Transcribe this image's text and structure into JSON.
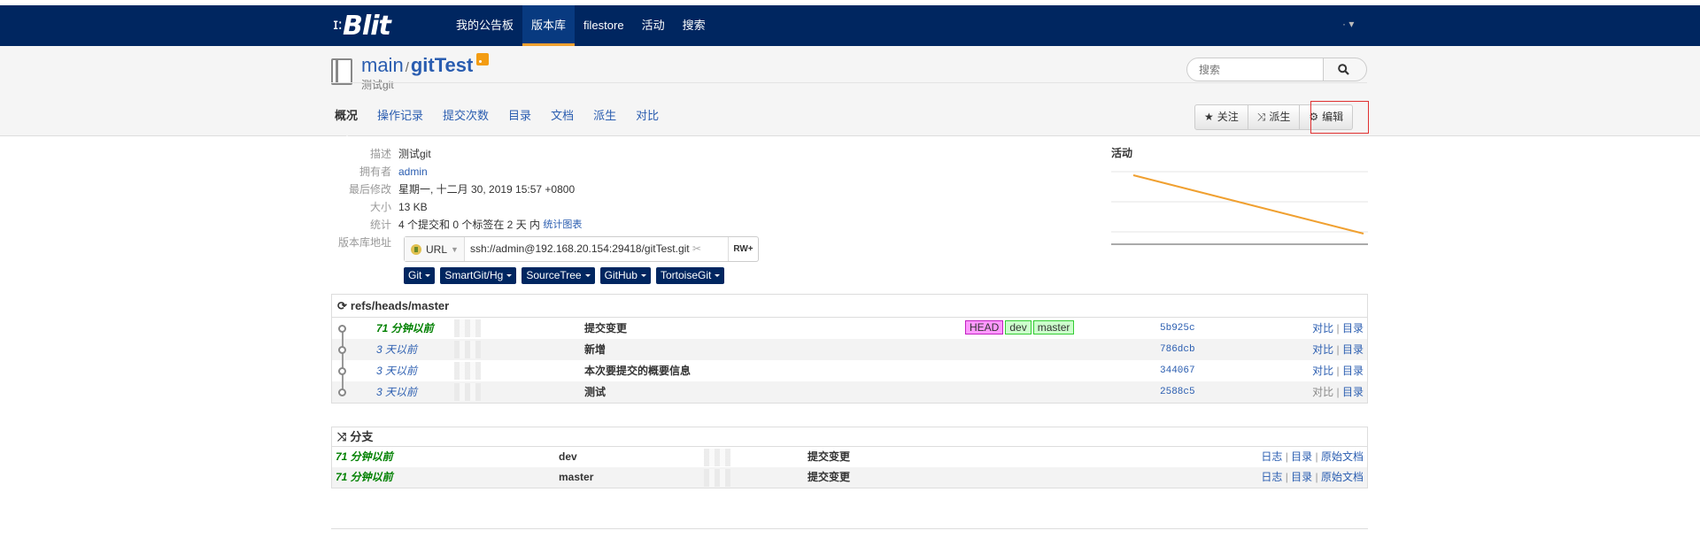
{
  "nav": {
    "brand": "Blit",
    "brand_prefix": "ɪ:",
    "items": [
      "我的公告板",
      "版本库",
      "filestore",
      "活动",
      "搜索"
    ],
    "active_index": 1,
    "user_menu": "·"
  },
  "repo": {
    "project": "main",
    "separator": "/",
    "name": "gitTest",
    "description": "测试git"
  },
  "search": {
    "placeholder": "搜索"
  },
  "tabs": [
    "概况",
    "操作记录",
    "提交次数",
    "目录",
    "文档",
    "派生",
    "对比"
  ],
  "actions": {
    "watch": "关注",
    "fork": "派生",
    "edit": "编辑"
  },
  "meta": {
    "description_label": "描述",
    "description": "测试git",
    "owner_label": "拥有者",
    "owner": "admin",
    "modified_label": "最后修改",
    "modified": "星期一, 十二月 30, 2019 15:57 +0800",
    "size_label": "大小",
    "size": "13 KB",
    "stats_label": "统计",
    "stats": "4 个提交和 0 个标签在 2 天 内",
    "stats_link": "统计图表",
    "url_label": "版本库地址"
  },
  "clone": {
    "protocol": "URL",
    "url": "ssh://admin@192.168.20.154:29418/gitTest.git",
    "access": "RW+"
  },
  "clients": [
    "Git",
    "SmartGit/Hg",
    "SourceTree",
    "GitHub",
    "TortoiseGit"
  ],
  "activity": {
    "title": "活动",
    "values": [
      1,
      0
    ]
  },
  "commits": {
    "title": "refs/heads/master",
    "rows": [
      {
        "age": "71 分钟以前",
        "recent": true,
        "message": "提交变更",
        "refs": [
          "HEAD",
          "dev",
          "master"
        ],
        "hash": "5b925c",
        "links": [
          "对比",
          "目录"
        ]
      },
      {
        "age": "3 天以前",
        "recent": false,
        "message": "新增",
        "refs": [],
        "hash": "786dcb",
        "links": [
          "对比",
          "目录"
        ]
      },
      {
        "age": "3 天以前",
        "recent": false,
        "message": "本次要提交的概要信息",
        "refs": [],
        "hash": "344067",
        "links": [
          "对比",
          "目录"
        ]
      },
      {
        "age": "3 天以前",
        "recent": false,
        "message": "测试",
        "refs": [],
        "hash": "2588c5",
        "links": [
          "对比",
          "目录"
        ]
      }
    ]
  },
  "branches": {
    "title": "分支",
    "rows": [
      {
        "age": "71 分钟以前",
        "name": "dev",
        "message": "提交变更",
        "links": [
          "日志",
          "目录",
          "原始文档"
        ]
      },
      {
        "age": "71 分钟以前",
        "name": "master",
        "message": "提交变更",
        "links": [
          "日志",
          "目录",
          "原始文档"
        ]
      }
    ]
  }
}
